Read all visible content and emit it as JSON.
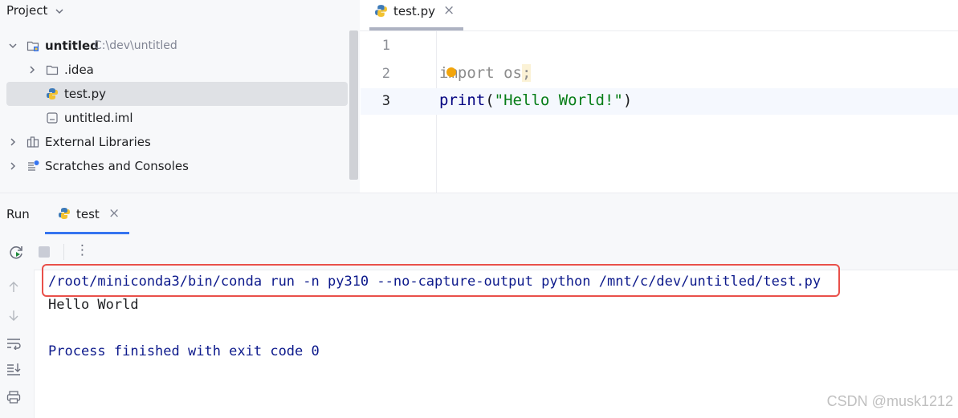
{
  "project": {
    "title": "Project",
    "root": {
      "name": "untitled",
      "path": "C:\\dev\\untitled"
    },
    "items": [
      {
        "label": ".idea"
      },
      {
        "label": "test.py"
      },
      {
        "label": "untitled.iml"
      },
      {
        "label": "External Libraries"
      },
      {
        "label": "Scratches and Consoles"
      }
    ]
  },
  "editor": {
    "tab": {
      "label": "test.py",
      "close": "×"
    },
    "lines": [
      {
        "num": "1",
        "code": ""
      },
      {
        "num": "2",
        "kw": "import",
        "rest": " os",
        "semi": ";"
      },
      {
        "num": "3",
        "fn": "print",
        "open": "(",
        "str": "\"Hello World!\"",
        "close": ")"
      }
    ]
  },
  "run": {
    "title": "Run",
    "tab": {
      "label": "test",
      "close": "×"
    },
    "more": "⋮",
    "console": [
      "/root/miniconda3/bin/conda run -n py310 --no-capture-output python /mnt/c/dev/untitled/test.py",
      "Hello World",
      "Process finished with exit code 0"
    ]
  },
  "watermark": "CSDN @musk1212",
  "colors": {
    "accent": "#3574f0",
    "selection": "#dfe1e5",
    "highlight_box": "#e9504a",
    "string_green": "#067d17",
    "console_blue": "#0d1a8c"
  }
}
